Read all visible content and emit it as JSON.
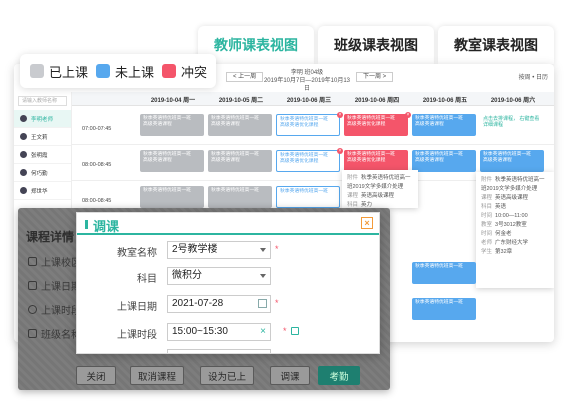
{
  "view_tabs": [
    {
      "label": "教师课表视图"
    },
    {
      "label": "班级课表视图"
    },
    {
      "label": "教室课表视图"
    }
  ],
  "legend": [
    {
      "label": "已上课",
      "color": "#c9cbcf"
    },
    {
      "label": "未上课",
      "color": "#57a8ee"
    },
    {
      "label": "冲突",
      "color": "#f4556a"
    }
  ],
  "toolbar": {
    "prev_label": "< 上一周",
    "next_label": "下一周 >",
    "teacher": "李明  班04级",
    "week_range": "2019年10月7日—2019年10月13日",
    "right_label": "按周 • 日历"
  },
  "sidebar": {
    "search_placeholder": "请输入教师名称",
    "items": [
      {
        "label": "李明老师"
      },
      {
        "label": "王文莉"
      },
      {
        "label": "张明霞"
      },
      {
        "label": "何巧勤"
      },
      {
        "label": "郑世华"
      }
    ]
  },
  "grid": {
    "days": [
      "2019-10-04 周一",
      "2019-10-05 周二",
      "2019-10-06 周三",
      "2019-10-06 周四",
      "2019-10-06 周五",
      "2019-10-06 周六"
    ],
    "times": [
      "07:00-07:45",
      "08:00-08:45",
      "08:00-08:45"
    ],
    "card_text_a": "秋季英语特优班高一班",
    "card_text_b": "高级英语课程",
    "card_text_c": "高级英语优化课程",
    "card_note": "高一班有合并课程",
    "card_warn": "点击去排课程，\n右键查看详细课程"
  },
  "detail_popup": {
    "rows": [
      {
        "k": "附件",
        "v": "秋季英语特优班高一班2019文学多媒介处理"
      },
      {
        "k": "课程",
        "v": "英语高级课程"
      },
      {
        "k": "科目",
        "v": "英语"
      },
      {
        "k": "时间",
        "v": "10:00—11:00"
      },
      {
        "k": "教室",
        "v": "3号3012教室"
      },
      {
        "k": "时间",
        "v": "何金老"
      },
      {
        "k": "老师",
        "v": "广东财经大学"
      },
      {
        "k": "学生",
        "v": "第32章"
      }
    ],
    "rows2": [
      {
        "k": "附件",
        "v": "秋季英语特优班高一班2019文学多媒介处理"
      },
      {
        "k": "课程",
        "v": "英语高级课程"
      },
      {
        "k": "科目",
        "v": "英力"
      }
    ]
  },
  "course_panel": {
    "title": "课程详情",
    "items": [
      "上课校区",
      "上课日期",
      "上课时段",
      "班级名称"
    ],
    "buttons": [
      "关闭",
      "取消课程",
      "设为已上",
      "调课",
      "考勤"
    ]
  },
  "dialog": {
    "title": "调课",
    "close_label": "×",
    "fields": [
      {
        "label": "教室名称",
        "value": "2号教学楼"
      },
      {
        "label": "科目",
        "value": "微积分"
      },
      {
        "label": "上课日期",
        "value": "2021-07-28"
      },
      {
        "label": "上课时段",
        "value": "15:00~15:30"
      }
    ],
    "required_mark": "*"
  }
}
